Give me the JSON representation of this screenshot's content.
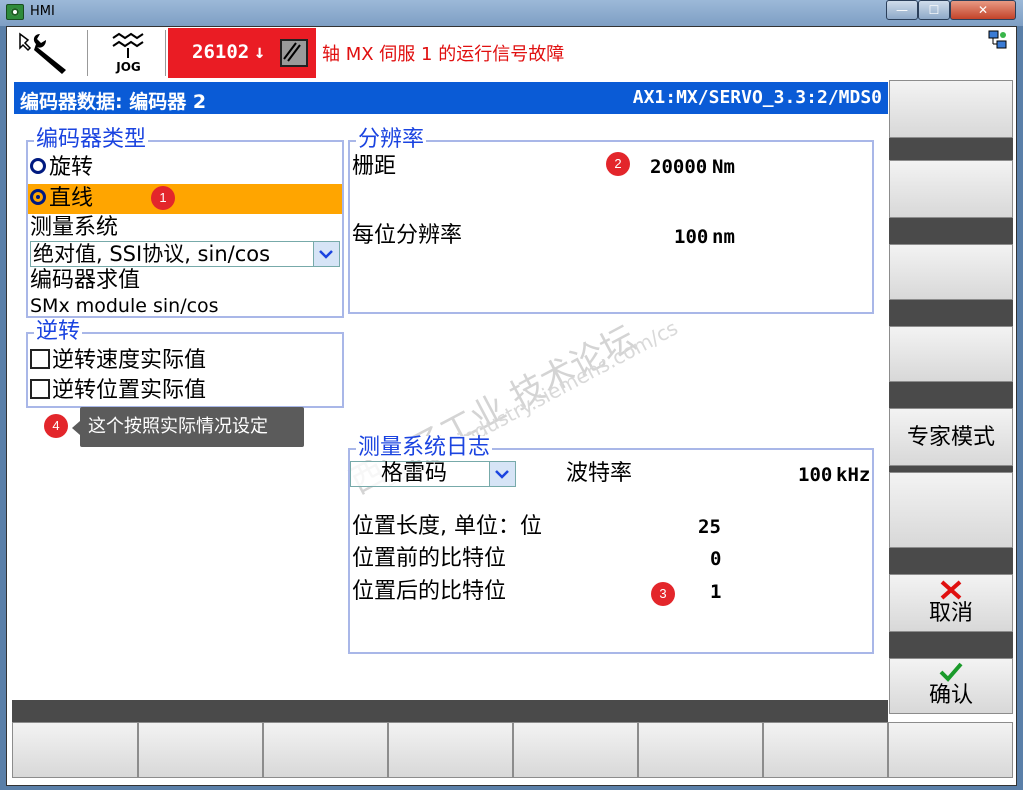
{
  "window": {
    "title": "HMI",
    "min": "—",
    "max": "☐",
    "close": "✕"
  },
  "header": {
    "jog_label": "JOG",
    "alarm_code": "26102",
    "alarm_arrow": "↓",
    "alarm_message": "轴 MX 伺服 1 的运行信号故障"
  },
  "titlebar": {
    "left": "编码器数据: 编码器 2",
    "right": "AX1:MX/SERVO_3.3:2/MDS0"
  },
  "encoder_type": {
    "title": "编码器类型",
    "rotary": "旋转",
    "linear": "直线",
    "meas_system_label": "测量系统",
    "meas_system_value": "绝对值, SSI协议, sin/cos",
    "eval_label": "编码器求值",
    "eval_value": "SMx module sin/cos"
  },
  "reversal": {
    "title": "逆转",
    "speed": "逆转速度实际值",
    "position": "逆转位置实际值"
  },
  "resolution": {
    "title": "分辨率",
    "pitch_label": "栅距",
    "pitch_value": "20000",
    "pitch_unit": "Nm",
    "per_bit_label": "每位分辨率",
    "per_bit_value": "100",
    "per_bit_unit": "nm"
  },
  "protocol": {
    "title": "测量系统日志",
    "code_value": "格雷码",
    "baud_label": "波特率",
    "baud_value": "100",
    "baud_unit": "kHz",
    "pos_len_label": "位置长度, 单位：位",
    "pos_len_value": "25",
    "bits_before_label": "位置前的比特位",
    "bits_before_value": "0",
    "bits_after_label": "位置后的比特位",
    "bits_after_value": "1"
  },
  "annotations": {
    "b1": "1",
    "b2": "2",
    "b3": "3",
    "b4": "4",
    "tooltip": "这个按照实际情况设定"
  },
  "watermark": {
    "line1": "西门子工业 技术论坛",
    "line2": "support.industry.siemens.com/cs"
  },
  "softkeys": {
    "expert": "专家模式",
    "cancel": "取消",
    "confirm": "确认"
  },
  "colors": {
    "alarm": "#ea1c24",
    "titlebar": "#0a5bd6",
    "selected_row": "#ffa500",
    "group_title": "#1b44e0"
  }
}
